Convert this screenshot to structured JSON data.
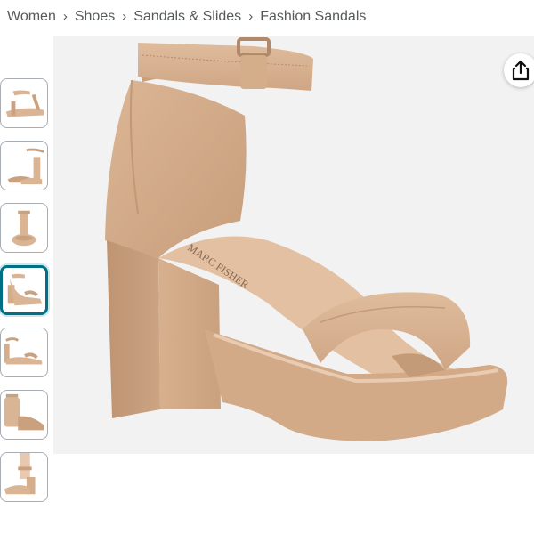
{
  "breadcrumb": {
    "items": [
      "Women",
      "Shoes",
      "Sandals & Slides",
      "Fashion Sandals"
    ],
    "separator": "›"
  },
  "gallery": {
    "thumbnail_count": 7,
    "selected_index": 3,
    "selected_border_color": "#007185"
  },
  "main_image": {
    "brand_imprint": "MARC FISHER",
    "product_color": "#d9b596"
  },
  "actions": {
    "share_icon": "share-icon"
  }
}
